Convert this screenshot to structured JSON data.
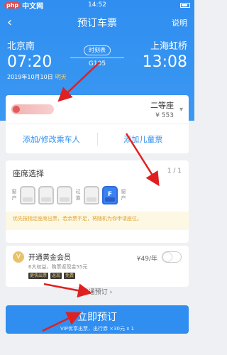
{
  "status_bar": {
    "watermark_php": "php",
    "watermark_text": "中文网",
    "time": "14:52"
  },
  "navbar": {
    "back_icon": "‹",
    "title": "预订车票",
    "help": "说明"
  },
  "trip": {
    "from_station": "北京南",
    "from_time": "07:20",
    "schedule_label": "时刻表",
    "train_no": "G105",
    "to_station": "上海虹桥",
    "to_time": "13:08",
    "date": "2019年10月10日",
    "day_label": "明天"
  },
  "passenger": {
    "seat_type": "二等座",
    "price": "¥ 553",
    "add_passenger": "添加/修改乘车人",
    "add_child": "添加儿童票"
  },
  "seat_selection": {
    "title": "座席选择",
    "count": "1 / 1",
    "left_label": "窗户",
    "aisle_label": "过道",
    "right_label": "窗户",
    "selected_seat": "F",
    "notice": "优先按指定座席出票，若余票不足，将随机为你申请座位。"
  },
  "vip": {
    "icon_text": "V",
    "title": "开通黄金会员",
    "subtitle": "6大权益，购票返现金55元",
    "price": "¥49/年",
    "tags": [
      "更快出票",
      "返现",
      "免费"
    ]
  },
  "normal_link": "普通预订 ›",
  "cta": {
    "label": "立即预订",
    "sub": "VIP优享出票，出行券 ×30元 x 1"
  },
  "colors": {
    "primary": "#2f8ef0",
    "arrow": "#e02020"
  }
}
